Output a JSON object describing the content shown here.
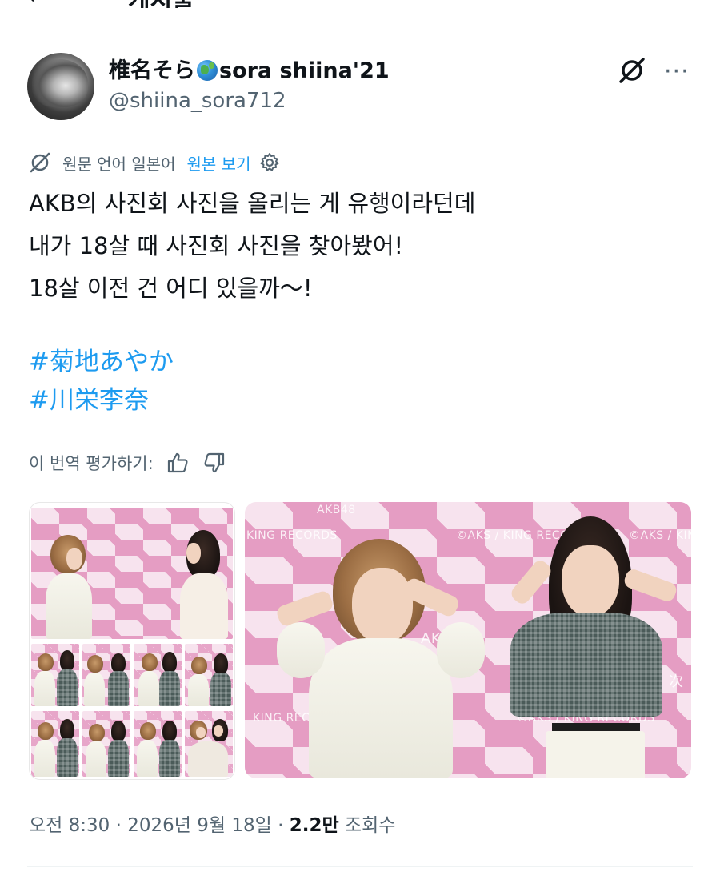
{
  "header": {
    "back_arrow": "←",
    "title": "게시물"
  },
  "author": {
    "display_name_prefix": "椎名そら",
    "globe_emoji": "globe-icon",
    "display_name_suffix": "sora shiina'21",
    "handle": "@shiina_sora712"
  },
  "actions": {
    "grok_icon": "grok-icon",
    "more_label": "···"
  },
  "translation": {
    "source_language_label": "원문 언어 일본어",
    "view_original_label": "원본 보기"
  },
  "tweet": {
    "lines": [
      "AKB의 사진회 사진을 올리는 게 유행이라던데",
      "내가 18살 때 사진회 사진을 찾아봤어!",
      "18살 이전 건 어디 있을까〜!"
    ],
    "hashtags": [
      "#菊地あやか",
      "#川栄李奈"
    ]
  },
  "rating": {
    "label": "이 번역 평가하기:"
  },
  "media": {
    "watermark_left_top": "AKB48",
    "watermark_records": "©AKS / KING RECORDS",
    "watermark_records_short": "KING RECORDS",
    "watermark_akb": "AKB48",
    "watermark_kanji": "次"
  },
  "meta": {
    "time": "오전 8:30",
    "separator": "·",
    "date": "2026년 9월 18일",
    "views_count": "2.2만",
    "views_label": "조회수"
  },
  "colors": {
    "accent": "#1d9bf0",
    "text_primary": "#0f1419",
    "text_secondary": "#536471",
    "backdrop_pink": "#e59dc3"
  }
}
